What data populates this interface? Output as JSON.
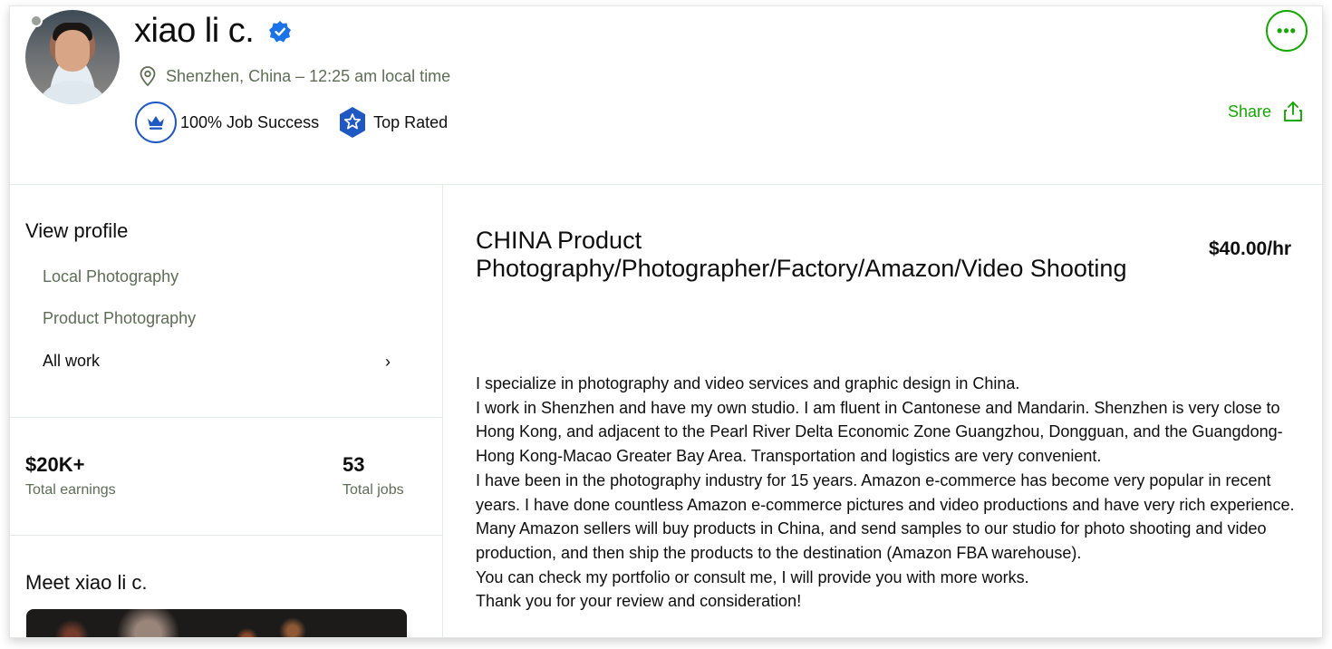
{
  "profile": {
    "name": "xiao li c.",
    "location": "Shenzhen, China – 12:25 am local time",
    "job_success": "100% Job Success",
    "top_rated": "Top Rated",
    "share_label": "Share",
    "more_label": "•••"
  },
  "sidebar": {
    "view_profile": "View profile",
    "items": [
      {
        "label": "Local Photography"
      },
      {
        "label": "Product Photography"
      },
      {
        "label": "All work"
      }
    ],
    "chevron": "›",
    "stats": {
      "earnings_value": "$20K+",
      "earnings_label": "Total earnings",
      "jobs_value": "53",
      "jobs_label": "Total jobs"
    },
    "meet_title": "Meet xiao li c."
  },
  "main": {
    "title_line1": "CHINA Product",
    "title_line2": "Photography/Photographer/Factory/Amazon/Video Shooting",
    "rate": "$40.00/hr",
    "description": [
      "I specialize in photography and video services and graphic design in China.",
      "I work in Shenzhen and have my own studio. I am fluent in Cantonese and Mandarin. Shenzhen is very close to Hong Kong, and adjacent to the Pearl River Delta Economic Zone Guangzhou, Dongguan, and the Guangdong-Hong Kong-Macao Greater Bay Area. Transportation and logistics are very convenient.",
      "I have been in the photography industry for 15 years. Amazon e-commerce has become very popular in recent years. I have done countless Amazon e-commerce pictures and video productions and have very rich experience.",
      "Many Amazon sellers will buy products in China, and send samples to our studio for photo shooting and video production, and then ship the products to the destination (Amazon FBA warehouse).",
      "You can check my portfolio or consult me, I will provide you with more works.",
      "Thank you for your review and consideration!"
    ]
  },
  "colors": {
    "accent_green": "#14a800",
    "badge_blue": "#1f57c3",
    "verified_blue": "#108a00"
  }
}
